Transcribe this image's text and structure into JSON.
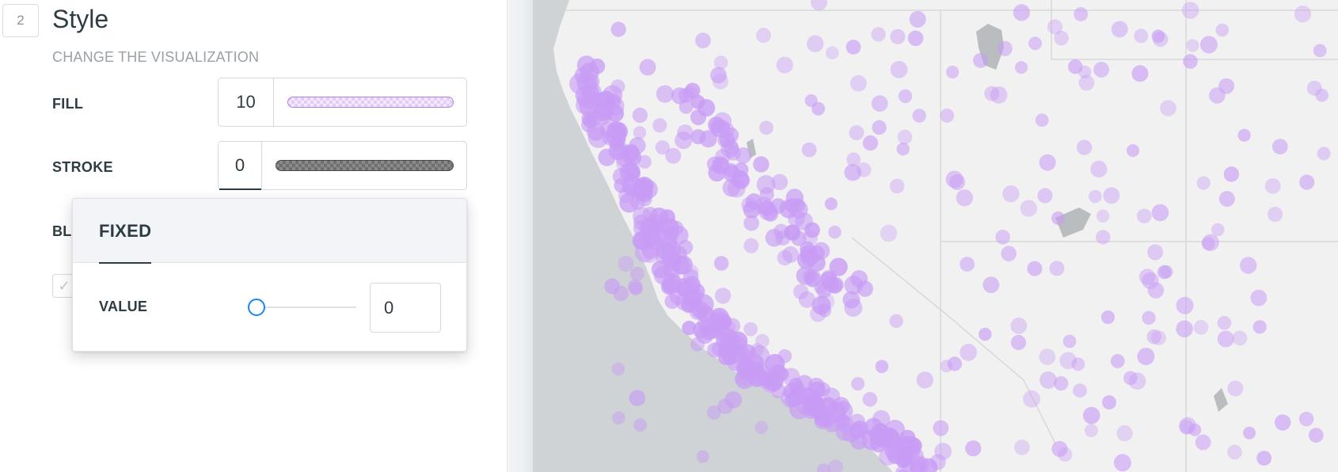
{
  "panel": {
    "step_number": "2",
    "title": "Style",
    "subtitle": "CHANGE THE VISUALIZATION",
    "fill": {
      "label": "FILL",
      "value": "10",
      "color": "#c89cf5"
    },
    "stroke": {
      "label": "STROKE",
      "value": "0",
      "color": "#5e5e5e"
    },
    "blending_label_partial": "BL",
    "checkbox_checked": true
  },
  "popover": {
    "tab": "FIXED",
    "value_label": "VALUE",
    "slider_level": 0,
    "input_value": "0",
    "accent": "#1785fb"
  },
  "map": {
    "point_color": "#c89cf5",
    "land_color": "#f1f1f1",
    "water_color": "#cfd3d5",
    "border_color": "#d8d8d8"
  }
}
